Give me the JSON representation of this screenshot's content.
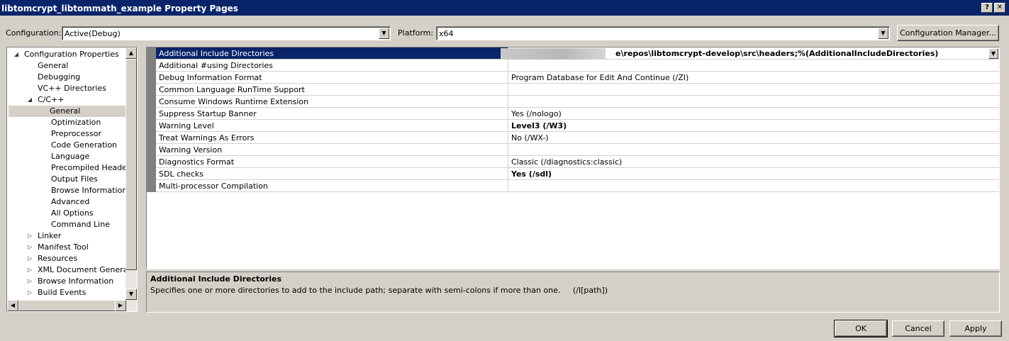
{
  "window": {
    "title": "libtomcrypt_libtommath_example Property Pages",
    "help_glyph": "?",
    "close_glyph": "✕"
  },
  "config": {
    "configuration_label": "Configuration:",
    "configuration_value": "Active(Debug)",
    "platform_label": "Platform:",
    "platform_value": "x64",
    "manager_button": "Configuration Manager..."
  },
  "tree": {
    "items": [
      {
        "label": "Configuration Properties",
        "expander": "◢"
      },
      {
        "label": "General"
      },
      {
        "label": "Debugging"
      },
      {
        "label": "VC++ Directories"
      },
      {
        "label": "C/C++",
        "expander": "◢"
      },
      {
        "label": "General",
        "selected": true
      },
      {
        "label": "Optimization"
      },
      {
        "label": "Preprocessor"
      },
      {
        "label": "Code Generation"
      },
      {
        "label": "Language"
      },
      {
        "label": "Precompiled Headers"
      },
      {
        "label": "Output Files"
      },
      {
        "label": "Browse Information"
      },
      {
        "label": "Advanced"
      },
      {
        "label": "All Options"
      },
      {
        "label": "Command Line"
      },
      {
        "label": "Linker",
        "expander": "▷"
      },
      {
        "label": "Manifest Tool",
        "expander": "▷"
      },
      {
        "label": "Resources",
        "expander": "▷"
      },
      {
        "label": "XML Document Generator",
        "expander": "▷"
      },
      {
        "label": "Browse Information",
        "expander": "▷"
      },
      {
        "label": "Build Events",
        "expander": "▷"
      }
    ]
  },
  "properties": {
    "rows": [
      {
        "name": "Additional Include Directories",
        "value": "e\\repos\\libtomcrypt-develop\\src\\headers;%(AdditionalIncludeDirectories)",
        "bold": true,
        "selected": true
      },
      {
        "name": "Additional #using Directories",
        "value": ""
      },
      {
        "name": "Debug Information Format",
        "value": "Program Database for Edit And Continue (/ZI)"
      },
      {
        "name": "Common Language RunTime Support",
        "value": ""
      },
      {
        "name": "Consume Windows Runtime Extension",
        "value": ""
      },
      {
        "name": "Suppress Startup Banner",
        "value": "Yes (/nologo)"
      },
      {
        "name": "Warning Level",
        "value": "Level3 (/W3)",
        "bold": true
      },
      {
        "name": "Treat Warnings As Errors",
        "value": "No (/WX-)"
      },
      {
        "name": "Warning Version",
        "value": ""
      },
      {
        "name": "Diagnostics Format",
        "value": "Classic (/diagnostics:classic)"
      },
      {
        "name": "SDL checks",
        "value": "Yes (/sdl)",
        "bold": true
      },
      {
        "name": "Multi-processor Compilation",
        "value": ""
      }
    ]
  },
  "description": {
    "title": "Additional Include Directories",
    "text": "Specifies one or more directories to add to the include path; separate with semi-colons if more than one.     (/I[path])"
  },
  "buttons": {
    "ok": "OK",
    "cancel": "Cancel",
    "apply": "Apply"
  }
}
